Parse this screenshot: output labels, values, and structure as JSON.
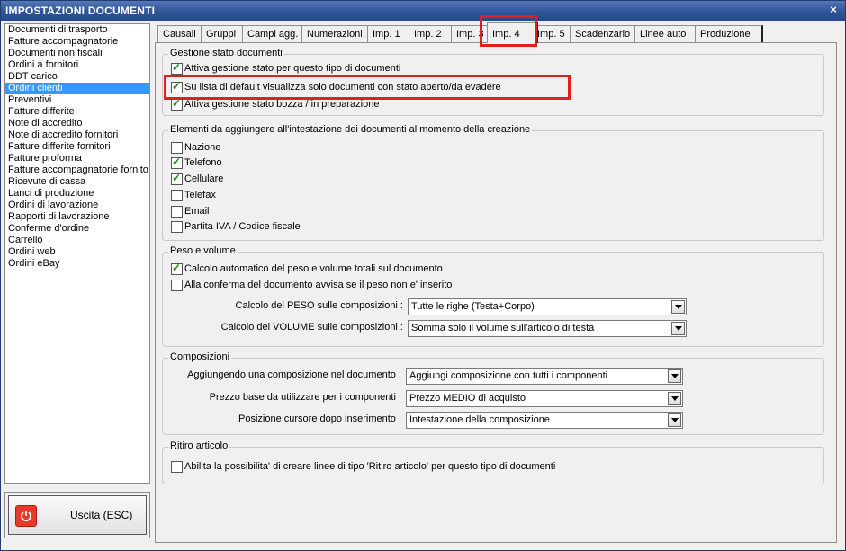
{
  "window": {
    "title": "IMPOSTAZIONI DOCUMENTI",
    "close_label": "×"
  },
  "doclist": {
    "items": [
      "Documenti di trasporto",
      "Fatture accompagnatorie",
      "Documenti non fiscali",
      "Ordini a fornitori",
      "DDT carico",
      "Ordini clienti",
      "Preventivi",
      "Fatture differite",
      "Note di accredito",
      "Note di accredito fornitori",
      "Fatture differite fornitori",
      "Fatture proforma",
      "Fatture accompagnatorie fornito",
      "Ricevute di cassa",
      "Lanci di produzione",
      "Ordini di lavorazione",
      "Rapporti di lavorazione",
      "Conferme d'ordine",
      "Carrello",
      "Ordini web",
      "Ordini eBay"
    ],
    "selected": "Ordini clienti"
  },
  "exit_button": {
    "label": "Uscita (ESC)"
  },
  "tabs": [
    "Causali",
    "Gruppi",
    "Campi agg.",
    "Numerazioni",
    "Imp. 1",
    "Imp. 2",
    "Imp. 3",
    "Imp. 4",
    "Imp. 5",
    "Scadenzario",
    "Linee auto",
    "Produzione"
  ],
  "active_tab": "Imp. 4",
  "stato": {
    "title": "Gestione stato documenti",
    "options": [
      {
        "label": "Attiva gestione stato per questo tipo di documenti",
        "checked": true
      },
      {
        "label": "Su lista di default visualizza solo documenti con stato aperto/da evadere",
        "checked": true
      },
      {
        "label": "Attiva gestione stato bozza / in preparazione",
        "checked": true
      }
    ]
  },
  "intestazione": {
    "title": "Elementi da aggiungere all'intestazione dei documenti al momento della creazione",
    "options": [
      {
        "label": "Nazione",
        "checked": false
      },
      {
        "label": "Telefono",
        "checked": true
      },
      {
        "label": "Cellulare",
        "checked": true
      },
      {
        "label": "Telefax",
        "checked": false
      },
      {
        "label": "Email",
        "checked": false
      },
      {
        "label": "Partita IVA / Codice fiscale",
        "checked": false
      }
    ]
  },
  "peso": {
    "title": "Peso e volume",
    "options": [
      {
        "label": "Calcolo automatico del peso e volume totali sul documento",
        "checked": true
      },
      {
        "label": "Alla conferma del documento avvisa se il peso non e' inserito",
        "checked": false
      }
    ],
    "fields": [
      {
        "label": "Calcolo del PESO sulle composizioni :",
        "value": "Tutte le righe (Testa+Corpo)"
      },
      {
        "label": "Calcolo del VOLUME sulle composizioni :",
        "value": "Somma solo il volume sull'articolo di testa"
      }
    ]
  },
  "composizioni": {
    "title": "Composizioni",
    "fields": [
      {
        "label": "Aggiungendo una composizione nel documento :",
        "value": "Aggiungi composizione con tutti i componenti"
      },
      {
        "label": "Prezzo base da utilizzare per i componenti :",
        "value": "Prezzo MEDIO di acquisto"
      },
      {
        "label": "Posizione cursore dopo inserimento :",
        "value": "Intestazione della composizione"
      }
    ]
  },
  "ritiro": {
    "title": "Ritiro articolo",
    "options": [
      {
        "label": "Abilita la possibilita' di creare linee di tipo 'Ritiro articolo' per questo tipo di documenti",
        "checked": false
      }
    ]
  },
  "colors": {
    "titlebar": "#2f5596",
    "selection": "#3399ff",
    "highlight": "#e0201c",
    "check": "#1a8a1a"
  }
}
